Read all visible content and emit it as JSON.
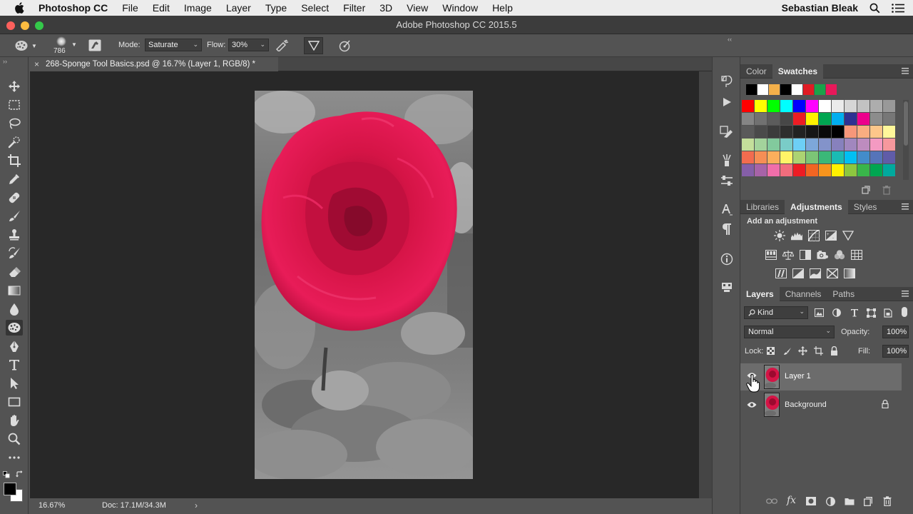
{
  "menubar": {
    "app_name": "Photoshop CC",
    "items": [
      "File",
      "Edit",
      "Image",
      "Layer",
      "Type",
      "Select",
      "Filter",
      "3D",
      "View",
      "Window",
      "Help"
    ],
    "user": "Sebastian Bleak"
  },
  "window": {
    "title": "Adobe Photoshop CC 2015.5"
  },
  "options": {
    "brush_size": "786",
    "mode_label": "Mode:",
    "mode_value": "Saturate",
    "flow_label": "Flow:",
    "flow_value": "30%"
  },
  "document": {
    "tab_title": "268-Sponge Tool Basics.psd @ 16.7% (Layer 1, RGB/8) *",
    "zoom": "16.67%",
    "doc_info": "Doc: 17.1M/34.3M"
  },
  "color_panel": {
    "tabs": [
      "Color",
      "Swatches"
    ],
    "active_tab": "Swatches",
    "recent_swatches": [
      "#000000",
      "#ffffff",
      "#f4b04a",
      "#000000",
      "#ffffff",
      "#e01b24",
      "#1aa34a",
      "#e8185a"
    ],
    "swatch_rows": [
      [
        "#ff0000",
        "#ffff00",
        "#00ff00",
        "#00ffff",
        "#0000ff",
        "#ff00ff",
        "#ffffff",
        "#ebebeb",
        "#d6d6d6",
        "#c2c2c2",
        "#adadad",
        "#999999"
      ],
      [
        "#858585",
        "#717171",
        "#5c5c5c",
        "#474747",
        "#ed1c24",
        "#fff200",
        "#00a651",
        "#00aeef",
        "#2e3192",
        "#ec008c",
        "#8c8c8c",
        "#777777"
      ],
      [
        "#5a5a5a",
        "#4a4a4a",
        "#3c3c3c",
        "#2e2e2e",
        "#222222",
        "#161616",
        "#0a0a0a",
        "#000000",
        "#f7977a",
        "#f9ad81",
        "#fdc68a",
        "#fff79a"
      ],
      [
        "#c4df9b",
        "#a3d39c",
        "#82ca9d",
        "#7accc8",
        "#6dcff6",
        "#7da7d9",
        "#8393ca",
        "#8781bd",
        "#a187be",
        "#bd8cbf",
        "#f49ac2",
        "#f6989d"
      ],
      [
        "#f26c4f",
        "#f68e55",
        "#fbaf5c",
        "#fff467",
        "#acd372",
        "#7cc576",
        "#3bb878",
        "#1abbb4",
        "#00bff3",
        "#438cca",
        "#5674b9",
        "#605ca8"
      ],
      [
        "#855fa8",
        "#a763a8",
        "#f06eaa",
        "#f26d7d",
        "#ed1c24",
        "#f26522",
        "#f7941d",
        "#fff200",
        "#8dc73f",
        "#39b54a",
        "#00a651",
        "#00a99d"
      ]
    ]
  },
  "adjustments_panel": {
    "tabs": [
      "Libraries",
      "Adjustments",
      "Styles"
    ],
    "active_tab": "Adjustments",
    "heading": "Add an adjustment"
  },
  "layers_panel": {
    "tabs": [
      "Layers",
      "Channels",
      "Paths"
    ],
    "active_tab": "Layers",
    "filter_label": "Kind",
    "blend_mode": "Normal",
    "opacity_label": "Opacity:",
    "opacity_value": "100%",
    "lock_label": "Lock:",
    "fill_label": "Fill:",
    "fill_value": "100%",
    "layers": [
      {
        "name": "Layer 1",
        "selected": true
      },
      {
        "name": "Background",
        "locked": true
      }
    ]
  }
}
